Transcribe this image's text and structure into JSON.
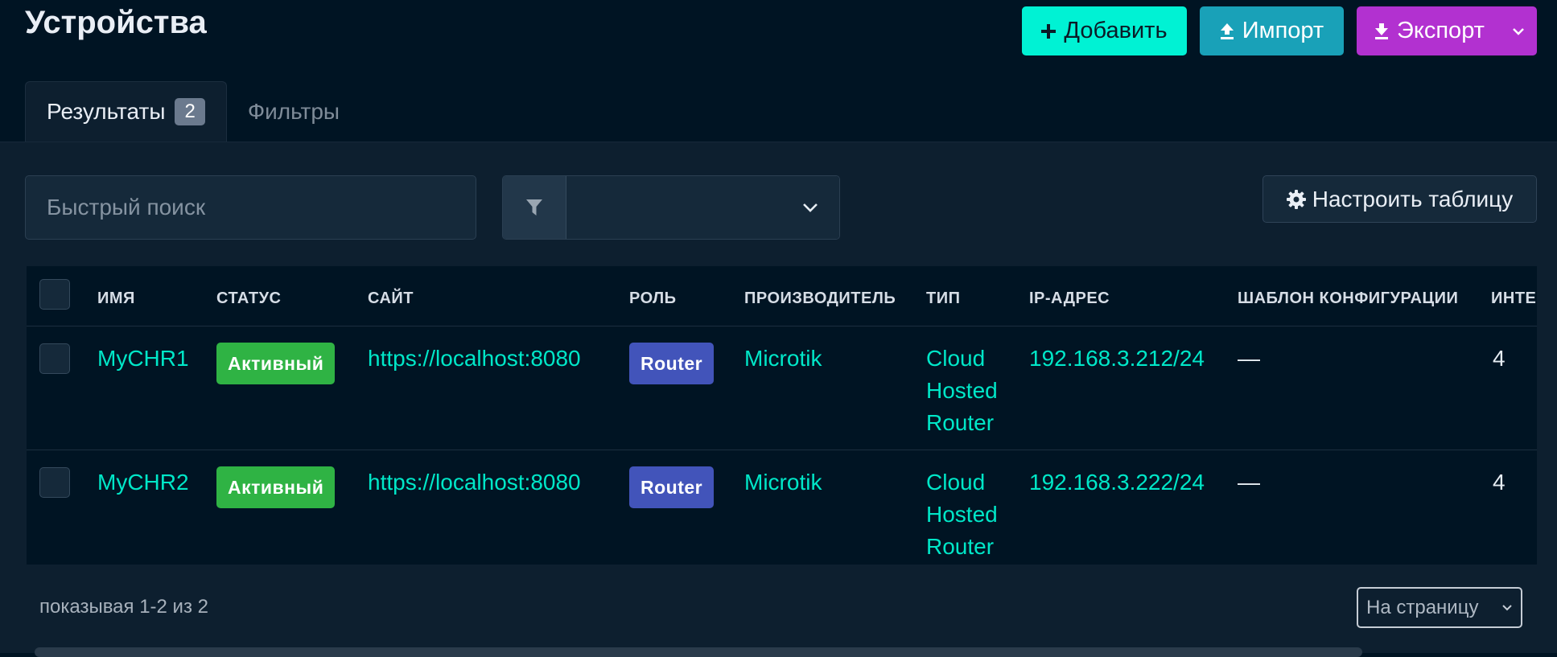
{
  "page": {
    "title": "Устройства"
  },
  "actions": {
    "add_label": "Добавить",
    "import_label": "Импорт",
    "export_label": "Экспорт"
  },
  "tabs": [
    {
      "label": "Результаты",
      "badge": "2",
      "active": true
    },
    {
      "label": "Фильтры",
      "active": false
    }
  ],
  "search": {
    "placeholder": "Быстрый поиск",
    "value": ""
  },
  "filter_select": {
    "value": ""
  },
  "configure_label": "Настроить таблицу",
  "table": {
    "columns": [
      "ИМЯ",
      "СТАТУС",
      "САЙТ",
      "РОЛЬ",
      "ПРОИЗВОДИТЕЛЬ",
      "ТИП",
      "IP-АДРЕС",
      "ШАБЛОН КОНФИГУРАЦИИ",
      "ИНТЕ"
    ],
    "rows": [
      {
        "name": "MyCHR1",
        "status": "Активный",
        "site": "https://localhost:8080",
        "role": "Router",
        "manufacturer": "Microtik",
        "type": "Cloud Hosted Router",
        "ip": "192.168.3.212/24",
        "config_template": "—",
        "interfaces": "4"
      },
      {
        "name": "MyCHR2",
        "status": "Активный",
        "site": "https://localhost:8080",
        "role": "Router",
        "manufacturer": "Microtik",
        "type": "Cloud Hosted Router",
        "ip": "192.168.3.222/24",
        "config_template": "—",
        "interfaces": "4"
      }
    ]
  },
  "pagination": {
    "summary": "показывая 1-2 из 2",
    "per_page_placeholder": "На страницу"
  },
  "colors": {
    "background": "#001423",
    "panel": "#0d1f2f",
    "accent_teal": "#00f2d4",
    "import_blue": "#19a1b8",
    "export_purple": "#b231d0",
    "status_green": "#2fb344",
    "role_indigo": "#4254ba",
    "link": "#00e7c8"
  },
  "icons": [
    "plus-icon",
    "upload-icon",
    "download-icon",
    "chevron-down-icon",
    "filter-icon",
    "gear-icon"
  ]
}
